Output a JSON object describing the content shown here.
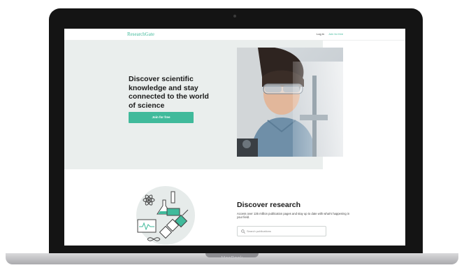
{
  "device": {
    "label": "MacBook"
  },
  "site": {
    "logo": "ResearchGate",
    "header": {
      "login": "Log in",
      "join": "Join for free"
    }
  },
  "hero": {
    "title": "Discover scientific knowledge and stay connected to the world of science",
    "button": "Join for free"
  },
  "discover": {
    "title": "Discover research",
    "description": "Access over 135 million publication pages and stay up to date with what's happening in your field.",
    "search_placeholder": "Search publications"
  },
  "colors": {
    "accent": "#40ba9b",
    "hero_bg": "#eaeeed",
    "laptop_bezel": "#141414"
  },
  "icons": [
    "search-icon",
    "atom-icon",
    "flask-icon",
    "chart-icon",
    "satellite-icon",
    "dna-icon"
  ]
}
